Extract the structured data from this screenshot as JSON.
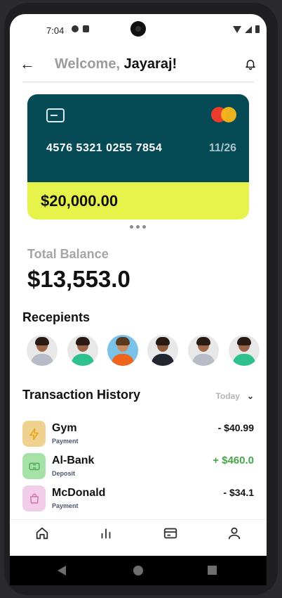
{
  "status_bar": {
    "time": "7:04"
  },
  "header": {
    "greeting": "Welcome,",
    "user_name": "Jayaraj!"
  },
  "card": {
    "number": "4576 5321 0255 7854",
    "expiry": "11/26",
    "amount": "$20,000.00",
    "colors": {
      "top": "#064a55",
      "bottom": "#e6f34a"
    }
  },
  "balance": {
    "label": "Total Balance",
    "value": "$13,553.0"
  },
  "recipients": {
    "title": "Recepients",
    "items": [
      {
        "avatar": "woman-grey-top"
      },
      {
        "avatar": "man-green-shirt"
      },
      {
        "avatar": "woman-orange-top"
      },
      {
        "avatar": "man-dark-shirt"
      },
      {
        "avatar": "woman-grey-top"
      },
      {
        "avatar": "man-green-shirt"
      }
    ]
  },
  "transactions": {
    "title": "Transaction History",
    "filter": "Today",
    "items": [
      {
        "name": "Gym",
        "type": "Payment",
        "amount": "- $40.99",
        "icon": "bolt-icon",
        "icon_bg": "#efd28f",
        "positive": false
      },
      {
        "name": "Al-Bank",
        "type": "Deposit",
        "amount": "+ $460.0",
        "icon": "ticket-icon",
        "icon_bg": "#a6e2a8",
        "positive": true
      },
      {
        "name": "McDonald",
        "type": "Payment",
        "amount": "- $34.1",
        "icon": "bag-icon",
        "icon_bg": "#f1cdea",
        "positive": false
      }
    ]
  },
  "bottom_nav": {
    "items": [
      {
        "icon": "home-icon"
      },
      {
        "icon": "chart-icon"
      },
      {
        "icon": "card-icon"
      },
      {
        "icon": "profile-icon"
      }
    ]
  }
}
